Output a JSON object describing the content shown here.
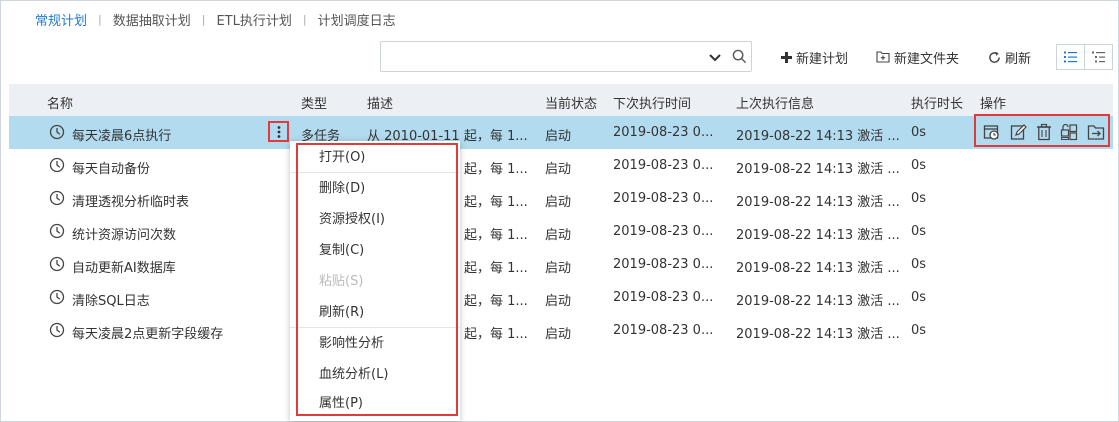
{
  "tabs": [
    "常规计划",
    "数据抽取计划",
    "ETL执行计划",
    "计划调度日志"
  ],
  "search": {
    "value": "",
    "placeholder": ""
  },
  "toolbar": {
    "new_plan": "新建计划",
    "new_folder": "新建文件夹",
    "refresh": "刷新"
  },
  "table": {
    "headers": {
      "name": "名称",
      "type": "类型",
      "desc": "描述",
      "status": "当前状态",
      "next_run": "下次执行时间",
      "last_info": "上次执行信息",
      "duration": "执行时长",
      "ops": "操作"
    },
    "rows": [
      {
        "name": "每天凌晨6点执行",
        "type": "多任务",
        "desc": "从 2010-01-11 起，每 1...",
        "status": "启动",
        "next_run": "2019-08-23 0...",
        "last_info": "2019-08-22 14:13 激活 ...",
        "duration": "0s"
      },
      {
        "name": "每天自动备份",
        "type": "",
        "desc": "起，每 1...",
        "status": "启动",
        "next_run": "2019-08-23 0...",
        "last_info": "2019-08-22 14:13 激活 ...",
        "duration": "0s"
      },
      {
        "name": "清理透视分析临时表",
        "type": "",
        "desc": "起，每 1...",
        "status": "启动",
        "next_run": "2019-08-23 0...",
        "last_info": "2019-08-22 14:13 激活 ...",
        "duration": "0s"
      },
      {
        "name": "统计资源访问次数",
        "type": "",
        "desc": "起，每 1...",
        "status": "启动",
        "next_run": "2019-08-23 0...",
        "last_info": "2019-08-22 14:13 激活 ...",
        "duration": "0s"
      },
      {
        "name": "自动更新AI数据库",
        "type": "",
        "desc": "起，每 1...",
        "status": "启动",
        "next_run": "2019-08-23 0...",
        "last_info": "2019-08-22 14:13 激活 ...",
        "duration": "0s"
      },
      {
        "name": "清除SQL日志",
        "type": "",
        "desc": "起，每 1...",
        "status": "启动",
        "next_run": "2019-08-23 0...",
        "last_info": "2019-08-22 14:13 激活 ...",
        "duration": "0s"
      },
      {
        "name": "每天凌晨2点更新字段缓存",
        "type": "",
        "desc": "起，每 1...",
        "status": "启动",
        "next_run": "2019-08-23 0...",
        "last_info": "2019-08-22 14:13 激活 ...",
        "duration": "0s"
      }
    ]
  },
  "row_actions": [
    "history-icon",
    "edit-icon",
    "delete-icon",
    "permission-icon",
    "export-icon"
  ],
  "context_menu": [
    {
      "label": "打开(O)",
      "disabled": false
    },
    {
      "label": "删除(D)",
      "disabled": false
    },
    {
      "label": "资源授权(I)",
      "disabled": false
    },
    {
      "label": "复制(C)",
      "disabled": false
    },
    {
      "label": "粘贴(S)",
      "disabled": true
    },
    {
      "label": "刷新(R)",
      "disabled": false
    },
    {
      "label": "影响性分析",
      "disabled": false
    },
    {
      "label": "血统分析(L)",
      "disabled": false
    },
    {
      "label": "属性(P)",
      "disabled": false
    }
  ],
  "colors": {
    "accent": "#1f7ad1",
    "selected_row": "#b3dbef",
    "highlight": "#e03b3b",
    "header_bg": "#eceff3"
  }
}
